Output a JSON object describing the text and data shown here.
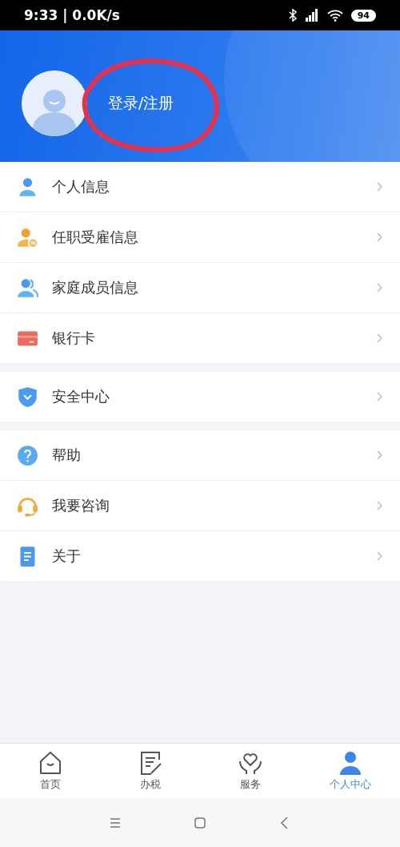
{
  "status_bar": {
    "time": "9:33 | 0.0K/s",
    "battery": "94"
  },
  "profile": {
    "login_label": "登录/注册"
  },
  "menu_groups": [
    [
      {
        "kind": "person",
        "label": "个人信息"
      },
      {
        "kind": "employment",
        "label": "任职受雇信息"
      },
      {
        "kind": "family",
        "label": "家庭成员信息"
      },
      {
        "kind": "card",
        "label": "银行卡"
      }
    ],
    [
      {
        "kind": "shield",
        "label": "安全中心"
      }
    ],
    [
      {
        "kind": "help",
        "label": "帮助"
      },
      {
        "kind": "headset",
        "label": "我要咨询"
      },
      {
        "kind": "document",
        "label": "关于"
      }
    ]
  ],
  "tabs": [
    {
      "kind": "home",
      "label": "首页",
      "selected": false
    },
    {
      "kind": "tax",
      "label": "办税",
      "selected": false
    },
    {
      "kind": "service",
      "label": "服务",
      "selected": false
    },
    {
      "kind": "person",
      "label": "个人中心",
      "selected": true
    }
  ]
}
